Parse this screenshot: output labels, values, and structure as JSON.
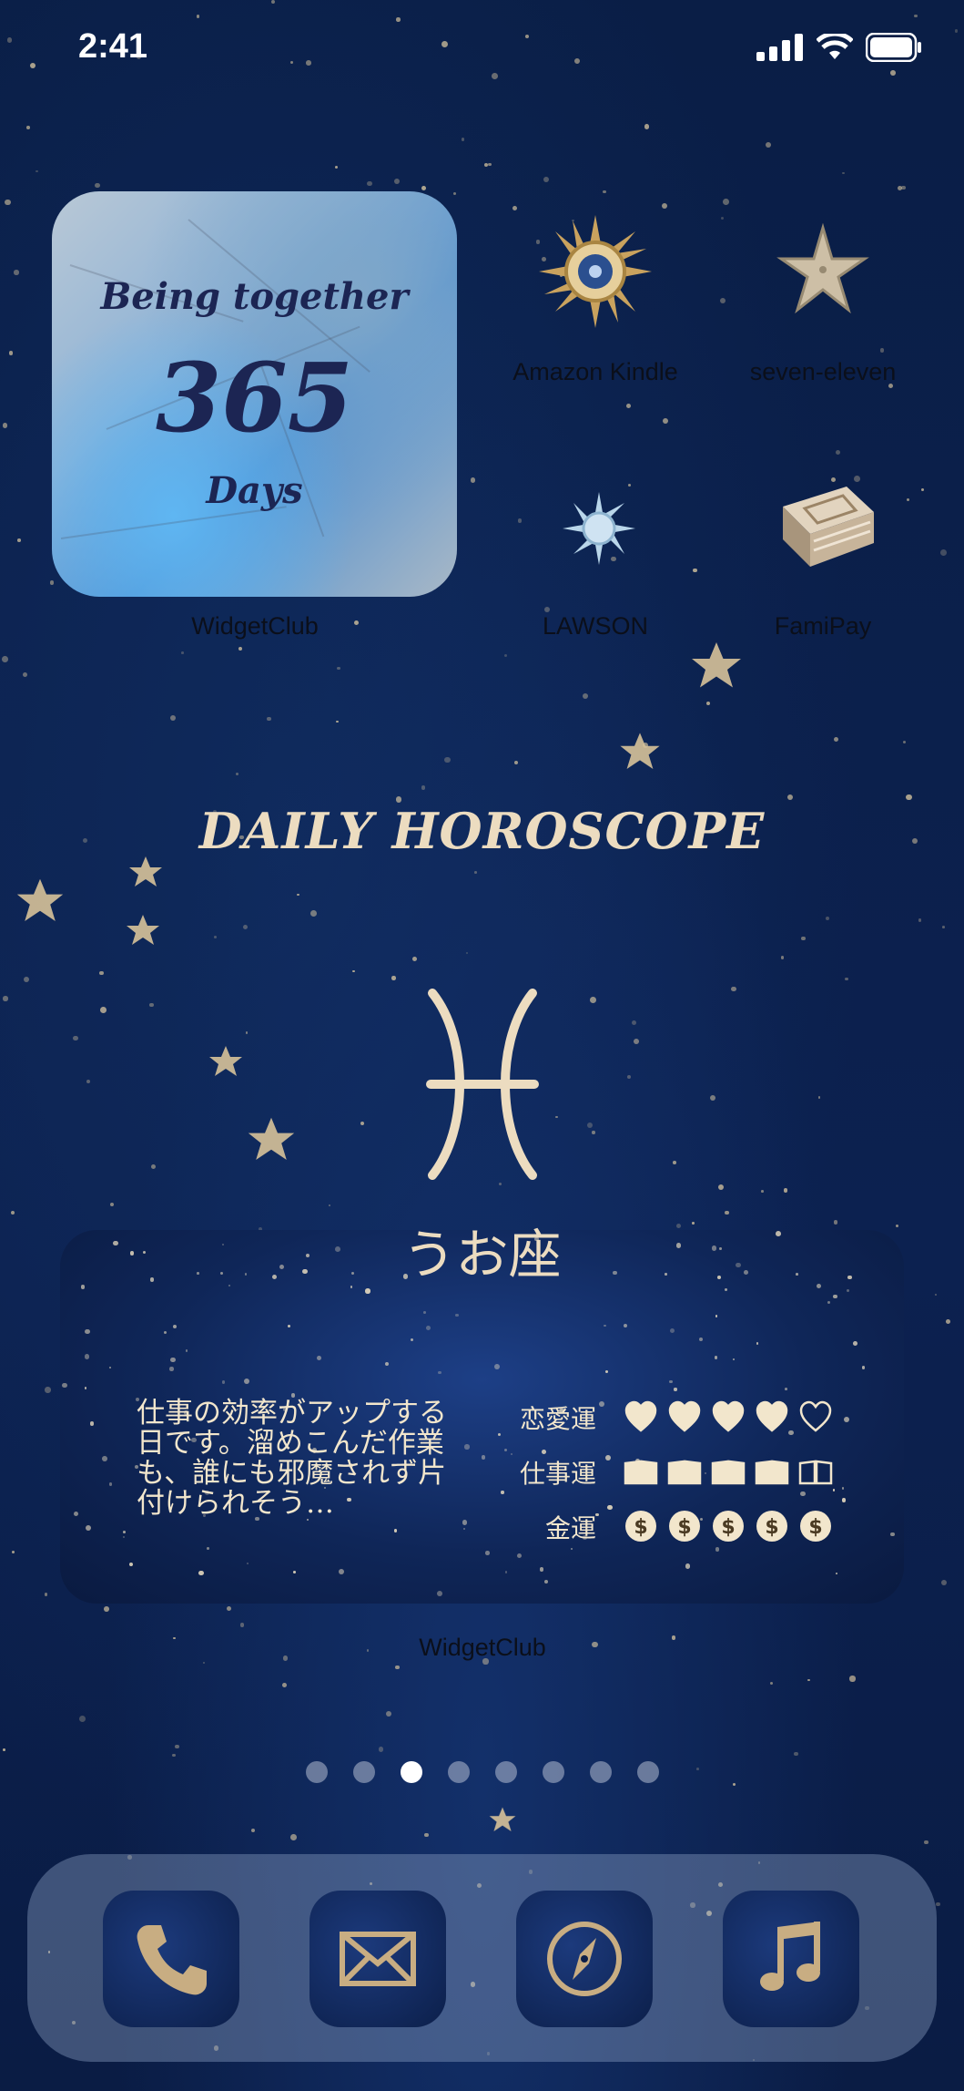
{
  "status_bar": {
    "time": "2:41"
  },
  "widget_top": {
    "line1": "Being together",
    "number": "365",
    "line3": "Days",
    "label": "WidgetClub"
  },
  "apps": [
    {
      "name": "Amazon Kindle",
      "icon": "sun-medallion-icon"
    },
    {
      "name": "seven-eleven",
      "icon": "starfish-icon"
    },
    {
      "name": "LAWSON",
      "icon": "snowflake-sun-icon"
    },
    {
      "name": "FamiPay",
      "icon": "antique-book-icon"
    }
  ],
  "horoscope": {
    "title": "DAILY HOROSCOPE",
    "sign_icon": "pisces-icon",
    "sign_name": "うお座",
    "message": "仕事の効率がアップする日です。溜めこんだ作業も、誰にも邪魔されず片付けられそう…",
    "ratings": [
      {
        "label": "恋愛運",
        "type": "heart",
        "value": 4,
        "max": 5
      },
      {
        "label": "仕事運",
        "type": "book",
        "value": 4,
        "max": 5
      },
      {
        "label": "金運",
        "type": "coin",
        "value": 5,
        "max": 5
      }
    ],
    "widget_label": "WidgetClub"
  },
  "page_indicator": {
    "count": 8,
    "active": 3
  },
  "dock": [
    {
      "icon": "phone-icon"
    },
    {
      "icon": "mail-icon"
    },
    {
      "icon": "compass-icon"
    },
    {
      "icon": "music-note-icon"
    }
  ],
  "colors": {
    "background": "#0b1f45",
    "gold": "#ecdcc0",
    "label_text": "#0b0f1a"
  }
}
